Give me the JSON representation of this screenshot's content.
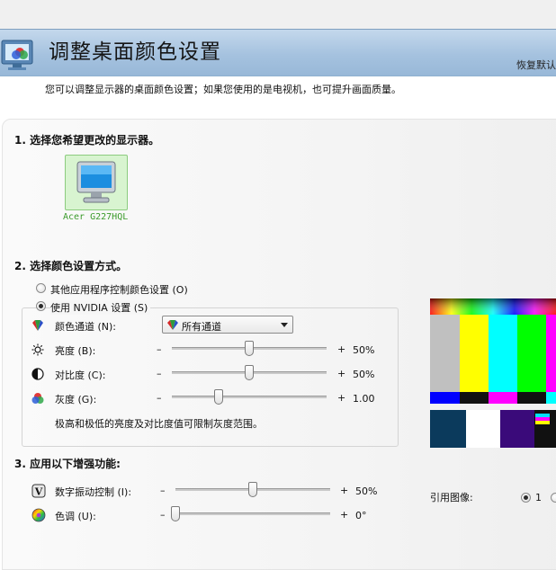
{
  "page": {
    "title": "调整桌面颜色设置",
    "restore_link": "恢复默认",
    "intro": "您可以调整显示器的桌面颜色设置；如果您使用的是电视机，也可提升画面质量。"
  },
  "section1": {
    "title": "1. 选择您希望更改的显示器。",
    "monitor_name": "Acer G227HQL"
  },
  "section2": {
    "title": "2. 选择颜色设置方式。",
    "radio_other": "其他应用程序控制颜色设置 (O)",
    "radio_nvidia": "使用 NVIDIA 设置 (S)",
    "channel": {
      "label": "颜色通道 (N):",
      "selected": "所有通道",
      "icon": "color-channel-icon"
    },
    "sliders": [
      {
        "key": "brightness",
        "label": "亮度 (B):",
        "minus": "–",
        "plus": "+",
        "display": "50%",
        "level": 0.5,
        "icon": "brightness-sun-icon"
      },
      {
        "key": "contrast",
        "label": "对比度 (C):",
        "minus": "–",
        "plus": "+",
        "display": "50%",
        "level": 0.5,
        "icon": "contrast-icon"
      },
      {
        "key": "gamma",
        "label": "灰度 (G):",
        "minus": "–",
        "plus": "+",
        "display": "1.00",
        "level": 0.3,
        "icon": "gamma-rgb-icon"
      }
    ],
    "note": "极高和极低的亮度及对比度值可限制灰度范围。"
  },
  "section3": {
    "title": "3. 应用以下增强功能:",
    "sliders": [
      {
        "key": "vibrance",
        "label": "数字振动控制 (I):",
        "minus": "–",
        "plus": "+",
        "display": "50%",
        "level": 0.5,
        "icon": "digital-vibrance-icon"
      },
      {
        "key": "hue",
        "label": "色调 (U):",
        "minus": "–",
        "plus": "+",
        "display": "0°",
        "level": 0.0,
        "icon": "hue-wheel-icon"
      }
    ]
  },
  "reference": {
    "label": "引用图像:",
    "option_1": "1"
  },
  "colors": {
    "banner": "#a9c4df",
    "monitor_selected_bg": "#d8f4d0",
    "monitor_label": "#3a9a2a"
  }
}
